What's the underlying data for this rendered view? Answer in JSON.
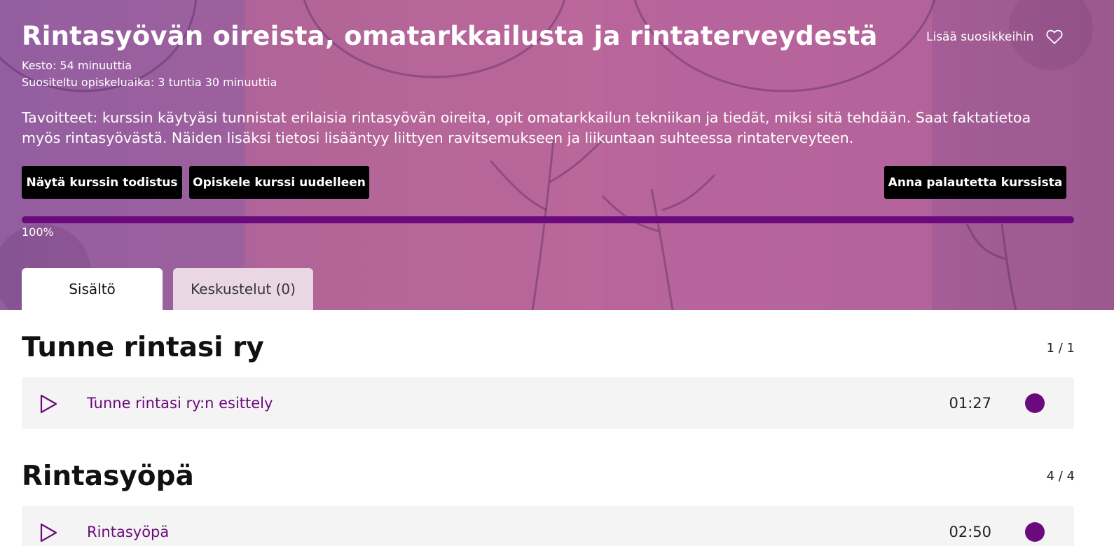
{
  "course": {
    "title": "Rintasyövän oireista, omatarkkailusta ja rintaterveydestä",
    "duration": "Kesto: 54 minuuttia",
    "recommended": "Suositeltu opiskeluaika: 3 tuntia 30 minuuttia",
    "goals": "Tavoitteet: kurssin käytyäsi tunnistat erilaisia rintasyövän oireita, opit omatarkkailun tekniikan ja tiedät, miksi sitä tehdään. Saat faktatietoa myös rintasyövästä. Näiden lisäksi tietosi lisääntyy liittyen ravitsemukseen ja liikuntaan suhteessa rintaterveyteen.",
    "favorite_label": "Lisää suosikkeihin",
    "favorite_icon": "heart-icon"
  },
  "actions": {
    "certificate": "Näytä kurssin todistus",
    "restudy": "Opiskele kurssi uudelleen",
    "feedback": "Anna palautetta kurssista"
  },
  "progress": {
    "value": 1.0,
    "label": "100%"
  },
  "tabs": [
    {
      "label": "Sisältö",
      "active": true
    },
    {
      "label": "Keskustelut (0)",
      "active": false
    }
  ],
  "sections": [
    {
      "title": "Tunne rintasi ry",
      "count": "1 / 1",
      "items": [
        {
          "title": "Tunne rintasi ry:n esittely",
          "duration": "01:27",
          "completed": true,
          "icon": "play-icon"
        }
      ]
    },
    {
      "title": "Rintasyöpä",
      "count": "4 / 4",
      "items": [
        {
          "title": "Rintasyöpä",
          "duration": "02:50",
          "completed": true,
          "icon": "play-icon"
        }
      ]
    }
  ],
  "colors": {
    "accent": "#6b0a7c",
    "hero": "#b3659d",
    "button": "#000000",
    "row_bg": "#f4f4f4",
    "inactive_tab": "#ead7e4"
  }
}
